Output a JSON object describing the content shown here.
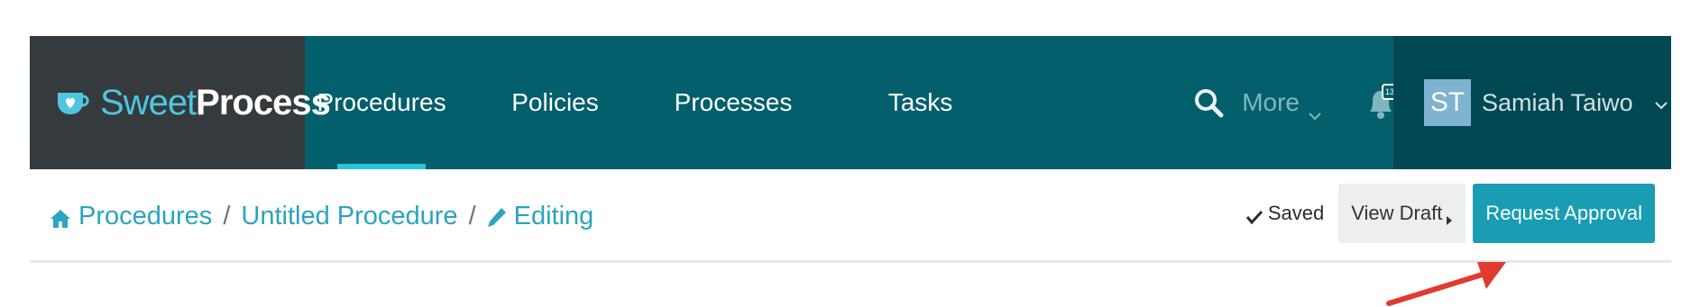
{
  "brand": {
    "name_light": "Sweet",
    "name_bold": "Process"
  },
  "nav": {
    "links": [
      {
        "label": "Procedures",
        "active": true
      },
      {
        "label": "Policies",
        "active": false
      },
      {
        "label": "Processes",
        "active": false
      },
      {
        "label": "Tasks",
        "active": false
      }
    ],
    "more_label": "More",
    "notification_count": "13"
  },
  "user": {
    "initials": "ST",
    "name": "Samiah Taiwo"
  },
  "breadcrumb": {
    "items": [
      "Procedures",
      "Untitled Procedure",
      "Editing"
    ],
    "separator": "/"
  },
  "actions": {
    "saved_label": "Saved",
    "view_draft_label": "View Draft",
    "request_approval_label": "Request Approval"
  },
  "icons": {
    "logo": "coffee-cup-heart-icon",
    "search": "search-icon",
    "more_chevron": "chevron-down-icon",
    "bell": "bell-icon",
    "user_chevron": "chevron-down-icon",
    "home": "home-icon",
    "edit": "pencil-icon",
    "saved": "check-icon",
    "draft": "caret-right-icon"
  },
  "colors": {
    "nav_bg": "#045f6d",
    "brand_bg": "#353a3e",
    "user_bg": "#024852",
    "accent": "#29c4d8",
    "link": "#2aa4bf",
    "primary_button": "#1a9cb3",
    "annotation_arrow": "#e23b2e"
  }
}
